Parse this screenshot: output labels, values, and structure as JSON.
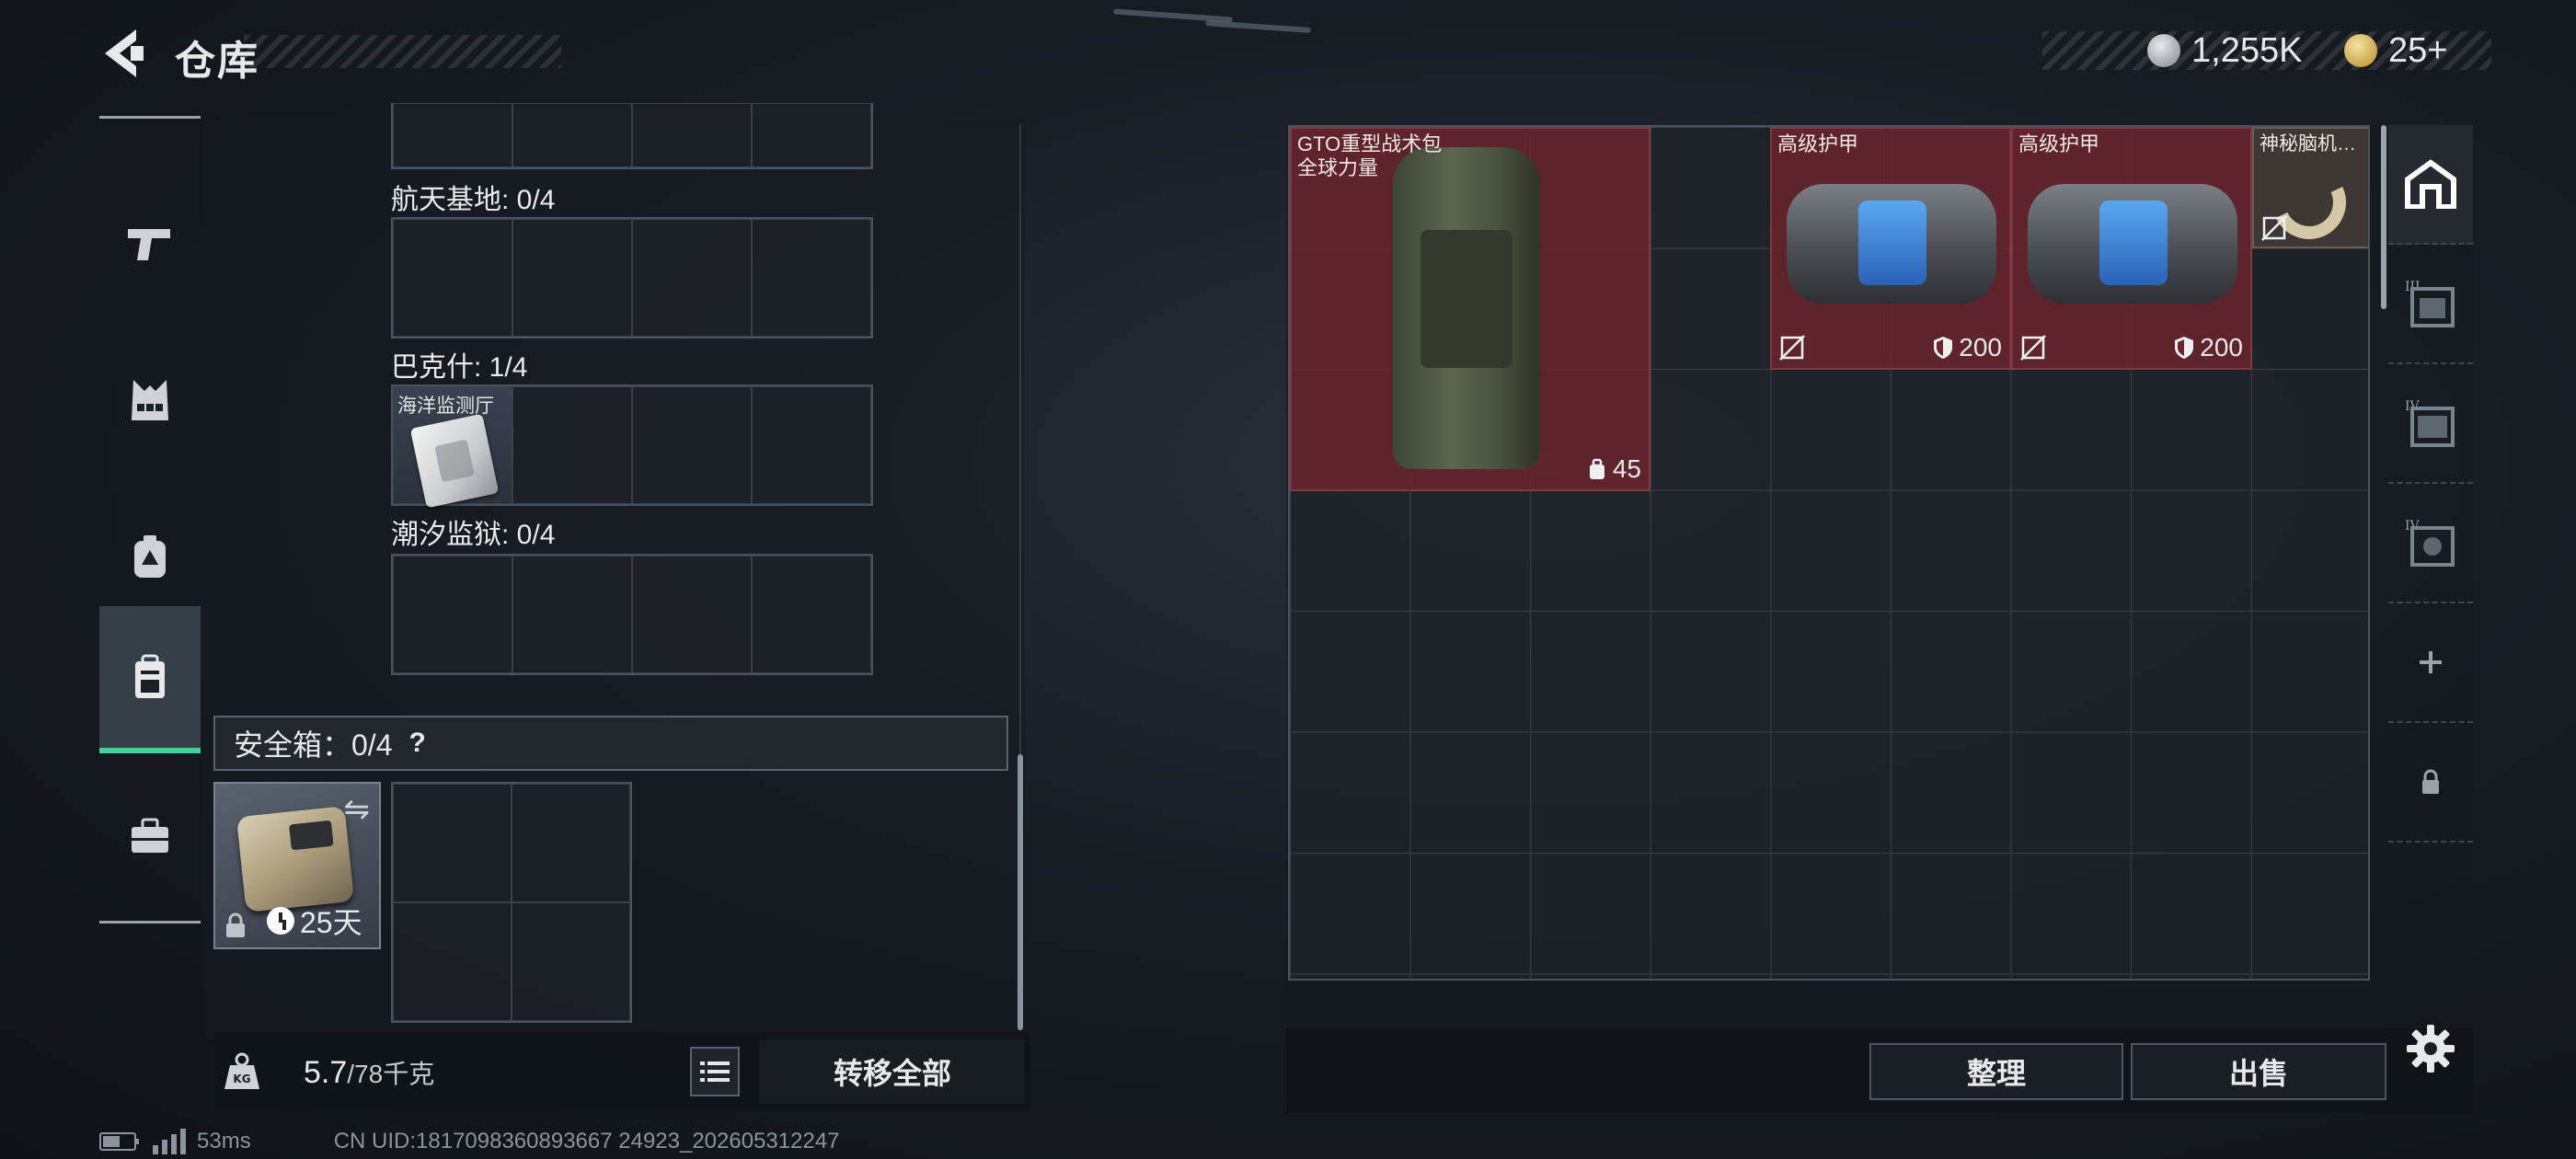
{
  "header": {
    "title": "仓库",
    "currency_silver": "1,255K",
    "currency_gold": "25+"
  },
  "left_rail": {
    "items": [
      {
        "name": "weapons",
        "icon": "pistol-icon",
        "active": false
      },
      {
        "name": "vest",
        "icon": "vest-icon",
        "active": false
      },
      {
        "name": "armor",
        "icon": "armor-plate-icon",
        "active": false
      },
      {
        "name": "backpack",
        "icon": "backpack-icon",
        "active": true
      },
      {
        "name": "case",
        "icon": "briefcase-icon",
        "active": false
      }
    ]
  },
  "stash": {
    "sections": [
      {
        "label": "航天基地: 0/4",
        "items": []
      },
      {
        "label": "巴克什: 1/4",
        "items": [
          {
            "name": "海洋监测厅"
          }
        ]
      },
      {
        "label": "潮汐监狱: 0/4",
        "items": []
      }
    ],
    "safe_box": {
      "label": "安全箱：0/4",
      "help": "?",
      "timer": "25天"
    },
    "weight": {
      "current": "5.7",
      "capacity": "/78千克"
    },
    "transfer_all": "转移全部"
  },
  "status": {
    "ping": "53ms",
    "uid": "CN UID:1817098360893667 24923_202605312247"
  },
  "container": {
    "items": [
      {
        "name_line1": "GTO重型战术包",
        "name_line2": "全球力量",
        "value": "45"
      },
      {
        "name_line1": "高级护甲",
        "value": "200"
      },
      {
        "name_line1": "高级护甲",
        "value": "200"
      },
      {
        "name_line1": "神秘脑机…"
      }
    ],
    "sort_button": "整理",
    "sell_button": "出售"
  },
  "right_rail": {
    "items": [
      {
        "name": "stash-home",
        "icon": "home-icon",
        "label": ""
      },
      {
        "name": "container-3",
        "icon": "container-icon",
        "label": "III"
      },
      {
        "name": "container-4a",
        "icon": "container-icon",
        "label": "IV"
      },
      {
        "name": "container-4b",
        "icon": "container-icon",
        "label": "IV"
      },
      {
        "name": "add",
        "icon": "plus-icon",
        "label": ""
      },
      {
        "name": "locked",
        "icon": "lock-icon",
        "label": ""
      }
    ]
  },
  "colors": {
    "accent": "#3fd39a",
    "item_red": "#6e242c",
    "text": "#e6e8ea"
  }
}
